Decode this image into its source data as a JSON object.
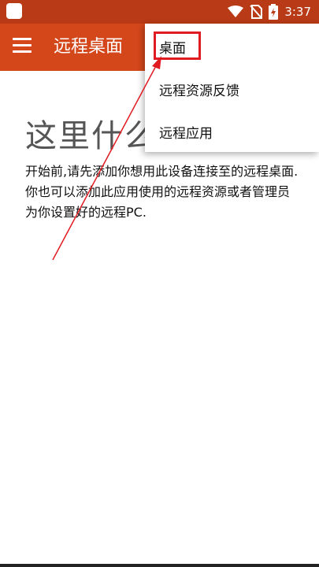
{
  "status_bar": {
    "time": "3:37",
    "icons": [
      "app-notification-icon",
      "wifi-icon",
      "no-sim-icon",
      "battery-charging-icon"
    ]
  },
  "app_bar": {
    "title": "远程桌面",
    "menu_icon": "hamburger-icon"
  },
  "empty_state": {
    "title": "这里什么",
    "description": "开始前,请先添加你想用此设备连接至的远程桌面.你也可以添加此应用使用的远程资源或者管理员为你设置好的远程PC."
  },
  "dropdown_menu": {
    "items": [
      {
        "label": "桌面"
      },
      {
        "label": "远程资源反馈"
      },
      {
        "label": "远程应用"
      }
    ]
  },
  "annotation": {
    "color": "#e11b22"
  },
  "colors": {
    "status_bar": "#b83a16",
    "app_bar": "#d4471b"
  }
}
